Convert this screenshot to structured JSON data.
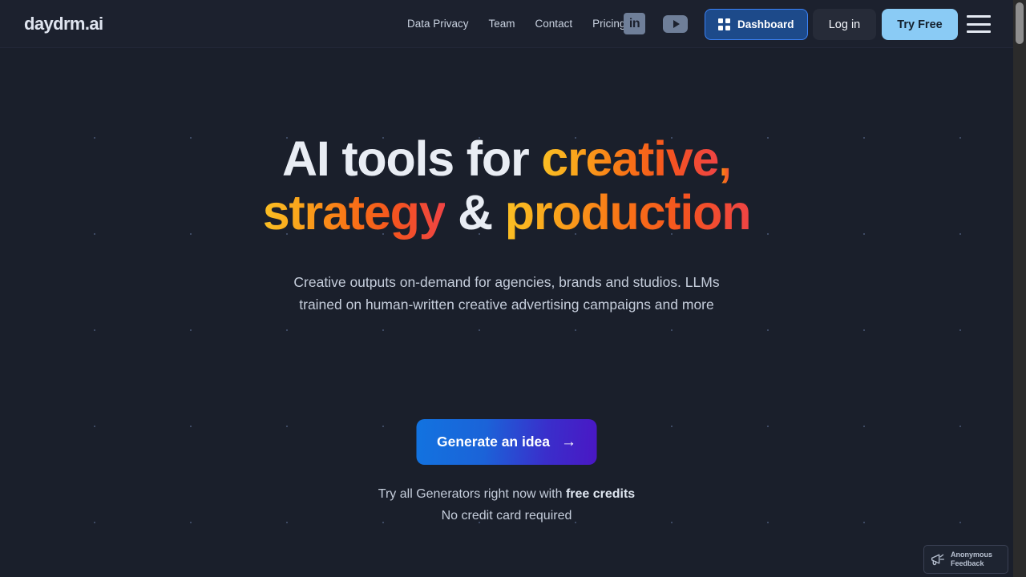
{
  "site": {
    "logo": "daydrm.ai"
  },
  "header": {
    "nav": [
      {
        "label": "Data Privacy",
        "name": "nav-link-data-privacy"
      },
      {
        "label": "Team",
        "name": "nav-link-team"
      },
      {
        "label": "Contact",
        "name": "nav-link-contact"
      },
      {
        "label": "Pricing",
        "name": "nav-link-pricing"
      }
    ],
    "social": {
      "linkedin_glyph": "in",
      "linkedin_name": "linkedin-icon",
      "youtube_name": "youtube-icon"
    },
    "dashboard_label": "Dashboard",
    "login_label": "Log in",
    "tryfree_label": "Try Free",
    "menu_name": "hamburger-menu-icon"
  },
  "hero": {
    "headline": {
      "line1_plain": "AI tools for ",
      "line1_accent": "creative",
      "line1_comma": ",",
      "line2_accent1": "strategy",
      "line2_plain": " & ",
      "line2_accent2": "production"
    },
    "subtitle": "Creative outputs on-demand for agencies, brands and studios. LLMs trained on human-written creative advertising campaigns and more",
    "cta_label": "Generate an idea",
    "cta_arrow": "→",
    "credits_line1_prefix": "Try all Generators right now with ",
    "credits_line1_bold": "free credits",
    "credits_line2": "No credit card required"
  },
  "feedback": {
    "line1": "Anonymous",
    "line2": "Feedback",
    "icon_name": "megaphone-icon"
  },
  "colors": {
    "background": "#1a1f2b",
    "header_bg": "#1c212e",
    "accent_blue": "#3b82f6",
    "tryfree_blue": "#8acbf5",
    "gradient_start": "#fbbf24",
    "gradient_mid": "#f97316",
    "gradient_end": "#ef4444",
    "cta_gradient_start": "#1273e0",
    "cta_gradient_end": "#4a17c4"
  }
}
